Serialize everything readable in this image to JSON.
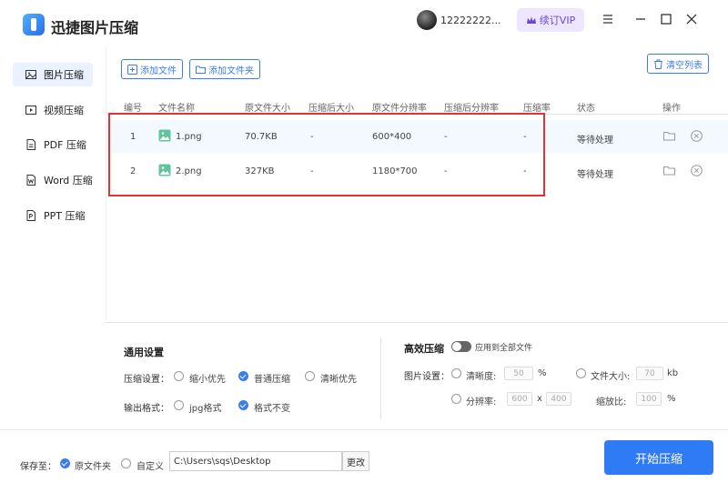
{
  "app": {
    "title": "迅捷图片压缩"
  },
  "user": {
    "name": "12222222..."
  },
  "vip": {
    "label": "续订VIP"
  },
  "sidebar": {
    "items": [
      {
        "label": "图片压缩",
        "icon": "image-icon"
      },
      {
        "label": "视频压缩",
        "icon": "video-icon"
      },
      {
        "label": "PDF 压缩",
        "icon": "pdf-icon"
      },
      {
        "label": "Word 压缩",
        "icon": "word-icon"
      },
      {
        "label": "PPT 压缩",
        "icon": "ppt-icon"
      }
    ]
  },
  "toolbar": {
    "add_file": "添加文件",
    "add_folder": "添加文件夹",
    "clear_list": "清空列表"
  },
  "table": {
    "headers": [
      "编号",
      "文件名称",
      "原文件大小",
      "压缩后大小",
      "原文件分辨率",
      "压缩后分辨率",
      "压缩率",
      "状态",
      "操作"
    ],
    "rows": [
      {
        "index": "1",
        "name": "1.png",
        "orig_size": "70.7KB",
        "comp_size": "-",
        "orig_res": "600*400",
        "comp_res": "-",
        "ratio": "-",
        "status": "等待处理"
      },
      {
        "index": "2",
        "name": "2.png",
        "orig_size": "327KB",
        "comp_size": "-",
        "orig_res": "1180*700",
        "comp_res": "-",
        "ratio": "-",
        "status": "等待处理"
      }
    ]
  },
  "settings": {
    "general_title": "通用设置",
    "compress_label": "压缩设置：",
    "compress_options": [
      "缩小优先",
      "普通压缩",
      "清晰优先"
    ],
    "compress_selected": "普通压缩",
    "format_label": "输出格式：",
    "format_options": [
      "jpg格式",
      "格式不变"
    ],
    "format_selected": "格式不变",
    "advanced_title": "高效压缩",
    "apply_all": "应用到全部文件",
    "image_label": "图片设置：",
    "clarity_label": "清晰度:",
    "clarity_value": "50",
    "clarity_unit": "%",
    "filesize_label": "文件大小:",
    "filesize_value": "70",
    "filesize_unit": "kb",
    "resolution_label": "分辨率:",
    "res_w": "600",
    "res_x": "x",
    "res_h": "400",
    "scale_label": "缩放比:",
    "scale_value": "100",
    "scale_unit": "%"
  },
  "footer": {
    "save_to": "保存至：",
    "option_original": "原文件夹",
    "option_custom": "自定义",
    "path": "C:\\Users\\sqs\\Desktop",
    "change": "更改",
    "start": "开始压缩"
  },
  "colors": {
    "accent": "#2f7bf5",
    "highlight_border": "#e03333",
    "vip_text": "#6b47d9"
  }
}
